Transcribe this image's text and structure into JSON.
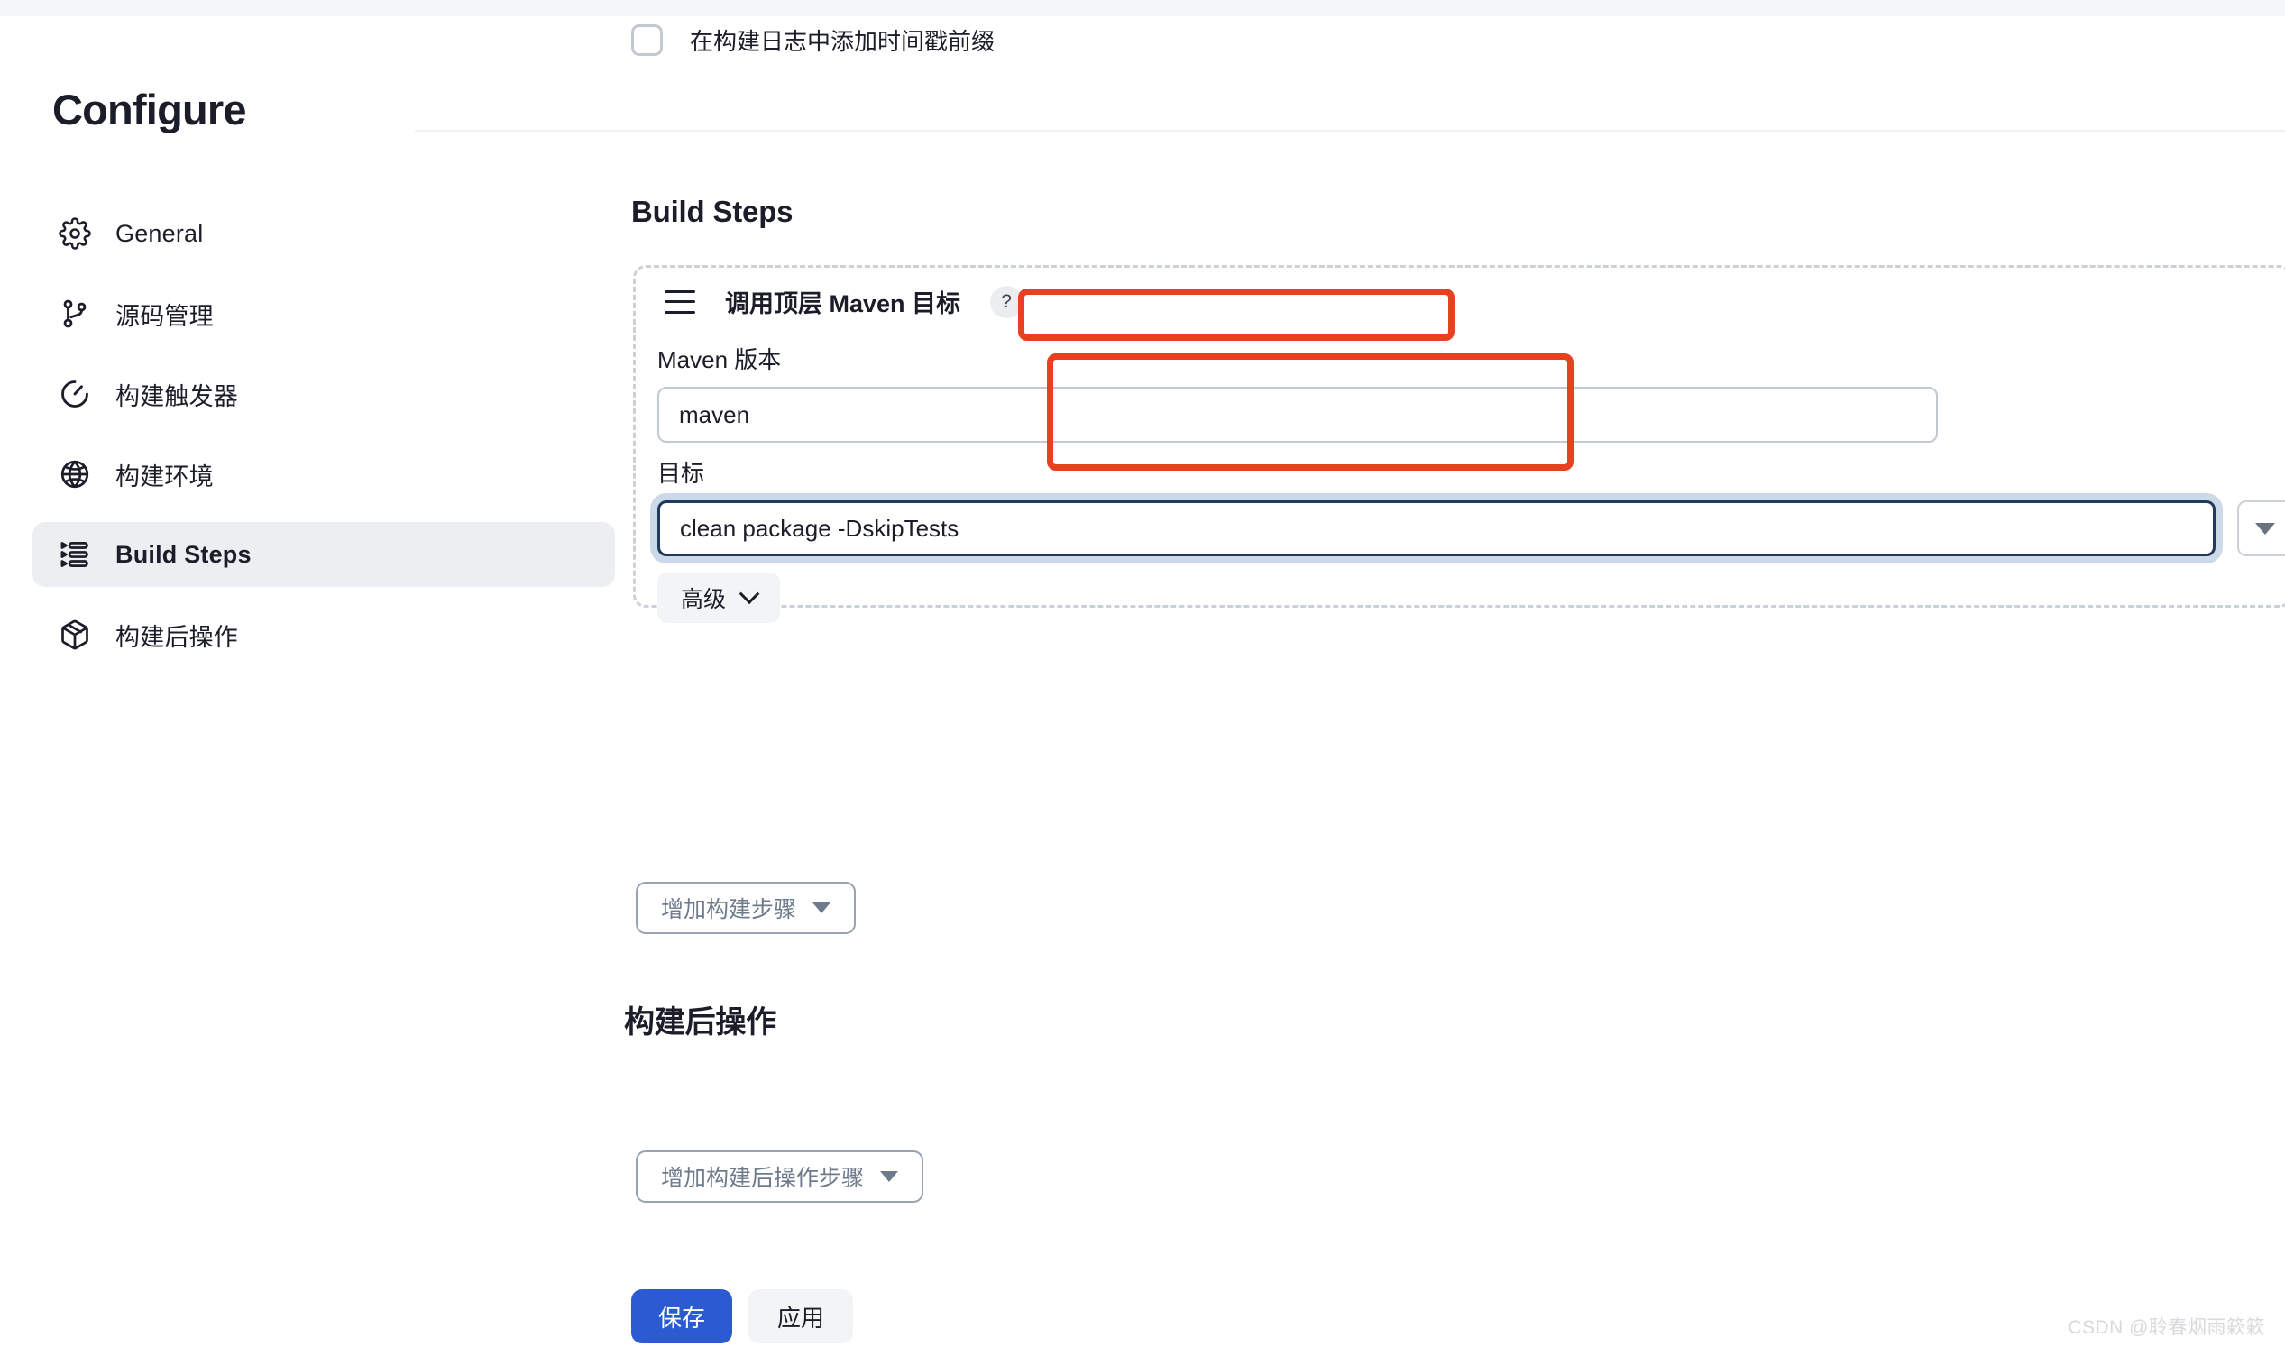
{
  "sidebar": {
    "title": "Configure",
    "items": [
      {
        "label": "General",
        "icon": "gear-icon",
        "active": false
      },
      {
        "label": "源码管理",
        "icon": "git-branch-icon",
        "active": false
      },
      {
        "label": "构建触发器",
        "icon": "clock-icon",
        "active": false
      },
      {
        "label": "构建环境",
        "icon": "globe-icon",
        "active": false
      },
      {
        "label": "Build Steps",
        "icon": "list-steps-icon",
        "active": true
      },
      {
        "label": "构建后操作",
        "icon": "package-icon",
        "active": false
      }
    ]
  },
  "main": {
    "timestamp_checkbox": {
      "label": "在构建日志中添加时间戳前缀",
      "checked": false
    },
    "build_steps_heading": "Build Steps",
    "step": {
      "title": "调用顶层 Maven 目标",
      "help_glyph": "?",
      "maven_version_label": "Maven 版本",
      "maven_version_value": "maven",
      "goals_label": "目标",
      "goals_value": "clean package -DskipTests",
      "advanced_label": "高级"
    },
    "add_build_step_label": "增加构建步骤",
    "post_build_heading": "构建后操作",
    "add_post_build_label": "增加构建后操作步骤",
    "save_label": "保存",
    "apply_label": "应用"
  },
  "watermark": "CSDN @聆春烟雨簌簌",
  "colors": {
    "accent_blue": "#2c5bd1",
    "annotation_red": "#e8411f",
    "focus_border": "#1f3a5c",
    "focus_ring": "#ccd9e8",
    "sidebar_active_bg": "#eceef2"
  }
}
